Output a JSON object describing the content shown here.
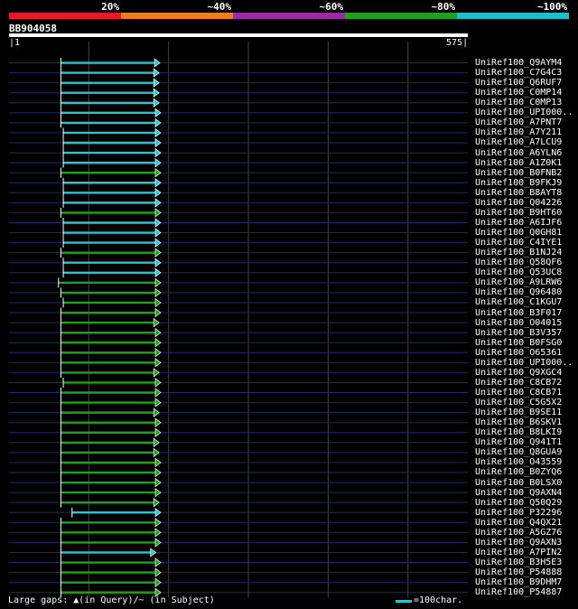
{
  "legend": [
    {
      "label": "20%",
      "color": "#e8182c"
    },
    {
      "label": "~40%",
      "color": "#ed7d1f"
    },
    {
      "label": "~60%",
      "color": "#9c2aa0"
    },
    {
      "label": "~80%",
      "color": "#21a01f"
    },
    {
      "label": "~100%",
      "color": "#1fbfc7"
    }
  ],
  "query": {
    "name": "BB904058",
    "start": "1",
    "end": "575",
    "length": 575
  },
  "colors": {
    "cyan": "#31c1cf",
    "green": "#21a01f",
    "track": "#1a2a6c",
    "grid": "#444444"
  },
  "hits": [
    {
      "name": "UniRef100_Q9AYM4",
      "start": 65,
      "end": 188,
      "color": "cyan"
    },
    {
      "name": "UniRef100_C7G4C3",
      "start": 65,
      "end": 187,
      "color": "cyan"
    },
    {
      "name": "UniRef100_Q6RUF7",
      "start": 65,
      "end": 187,
      "color": "cyan"
    },
    {
      "name": "UniRef100_C0MP14",
      "start": 65,
      "end": 187,
      "color": "cyan"
    },
    {
      "name": "UniRef100_C0MP13",
      "start": 65,
      "end": 187,
      "color": "cyan"
    },
    {
      "name": "UniRef100_UPI000..",
      "start": 65,
      "end": 189,
      "color": "cyan"
    },
    {
      "name": "UniRef100_A7PNT7",
      "start": 65,
      "end": 189,
      "color": "cyan"
    },
    {
      "name": "UniRef100_A7Y211",
      "start": 68,
      "end": 189,
      "color": "cyan"
    },
    {
      "name": "UniRef100_A7LCU9",
      "start": 68,
      "end": 189,
      "color": "cyan"
    },
    {
      "name": "UniRef100_A6YLN6",
      "start": 68,
      "end": 189,
      "color": "cyan"
    },
    {
      "name": "UniRef100_A1Z0K1",
      "start": 68,
      "end": 189,
      "color": "cyan"
    },
    {
      "name": "UniRef100_B0FNB2",
      "start": 65,
      "end": 189,
      "color": "green"
    },
    {
      "name": "UniRef100_B9FKJ9",
      "start": 68,
      "end": 189,
      "color": "cyan"
    },
    {
      "name": "UniRef100_B8AYT8",
      "start": 68,
      "end": 189,
      "color": "cyan"
    },
    {
      "name": "UniRef100_Q04226",
      "start": 68,
      "end": 189,
      "color": "cyan"
    },
    {
      "name": "UniRef100_B9HT60",
      "start": 65,
      "end": 189,
      "color": "green"
    },
    {
      "name": "UniRef100_A6IJF6",
      "start": 68,
      "end": 189,
      "color": "cyan"
    },
    {
      "name": "UniRef100_Q0GH81",
      "start": 68,
      "end": 189,
      "color": "cyan"
    },
    {
      "name": "UniRef100_C4IYE1",
      "start": 68,
      "end": 189,
      "color": "cyan"
    },
    {
      "name": "UniRef100_B1NJ24",
      "start": 65,
      "end": 189,
      "color": "green"
    },
    {
      "name": "UniRef100_Q58QF6",
      "start": 68,
      "end": 189,
      "color": "cyan"
    },
    {
      "name": "UniRef100_Q53UC8",
      "start": 68,
      "end": 189,
      "color": "cyan"
    },
    {
      "name": "UniRef100_A9LRW6",
      "start": 62,
      "end": 189,
      "color": "green"
    },
    {
      "name": "UniRef100_Q96480",
      "start": 65,
      "end": 189,
      "color": "green"
    },
    {
      "name": "UniRef100_C1KGU7",
      "start": 68,
      "end": 189,
      "color": "green"
    },
    {
      "name": "UniRef100_B3F017",
      "start": 65,
      "end": 189,
      "color": "green"
    },
    {
      "name": "UniRef100_O04015",
      "start": 65,
      "end": 187,
      "color": "green"
    },
    {
      "name": "UniRef100_B3V357",
      "start": 65,
      "end": 189,
      "color": "green"
    },
    {
      "name": "UniRef100_B0FSG0",
      "start": 65,
      "end": 189,
      "color": "green"
    },
    {
      "name": "UniRef100_O65361",
      "start": 65,
      "end": 189,
      "color": "green"
    },
    {
      "name": "UniRef100_UPI000..",
      "start": 65,
      "end": 189,
      "color": "green"
    },
    {
      "name": "UniRef100_Q9XGC4",
      "start": 65,
      "end": 187,
      "color": "green"
    },
    {
      "name": "UniRef100_C8CB72",
      "start": 68,
      "end": 189,
      "color": "green"
    },
    {
      "name": "UniRef100_C8CB71",
      "start": 65,
      "end": 189,
      "color": "green"
    },
    {
      "name": "UniRef100_C5G5X2",
      "start": 65,
      "end": 189,
      "color": "green"
    },
    {
      "name": "UniRef100_B9SE11",
      "start": 65,
      "end": 187,
      "color": "green"
    },
    {
      "name": "UniRef100_B6SKV1",
      "start": 65,
      "end": 189,
      "color": "green"
    },
    {
      "name": "UniRef100_B8LKI9",
      "start": 65,
      "end": 189,
      "color": "green"
    },
    {
      "name": "UniRef100_Q941T1",
      "start": 65,
      "end": 187,
      "color": "green"
    },
    {
      "name": "UniRef100_Q8GUA9",
      "start": 65,
      "end": 187,
      "color": "green"
    },
    {
      "name": "UniRef100_O43559",
      "start": 65,
      "end": 189,
      "color": "green"
    },
    {
      "name": "UniRef100_B0ZYQ6",
      "start": 65,
      "end": 189,
      "color": "green"
    },
    {
      "name": "UniRef100_B0LSX0",
      "start": 65,
      "end": 189,
      "color": "green"
    },
    {
      "name": "UniRef100_Q9AXN4",
      "start": 65,
      "end": 189,
      "color": "green"
    },
    {
      "name": "UniRef100_Q50Q29",
      "start": 65,
      "end": 187,
      "color": "green"
    },
    {
      "name": "UniRef100_P32296",
      "start": 79,
      "end": 189,
      "color": "cyan"
    },
    {
      "name": "UniRef100_Q4QX21",
      "start": 65,
      "end": 189,
      "color": "green"
    },
    {
      "name": "UniRef100_A5GZ76",
      "start": 65,
      "end": 189,
      "color": "green"
    },
    {
      "name": "UniRef100_Q9AXN3",
      "start": 65,
      "end": 189,
      "color": "green"
    },
    {
      "name": "UniRef100_A7PIN2",
      "start": 65,
      "end": 183,
      "color": "cyan"
    },
    {
      "name": "UniRef100_B3H5E3",
      "start": 65,
      "end": 189,
      "color": "green"
    },
    {
      "name": "UniRef100_P54888",
      "start": 65,
      "end": 189,
      "color": "green"
    },
    {
      "name": "UniRef100_B9DHM7",
      "start": 65,
      "end": 189,
      "color": "green"
    },
    {
      "name": "UniRef100_P54887",
      "start": 65,
      "end": 189,
      "color": "green"
    }
  ],
  "footer": {
    "gaps_text": "Large gaps: ▲(in Query)/~ (in Subject)",
    "scale_text": "=100char."
  }
}
